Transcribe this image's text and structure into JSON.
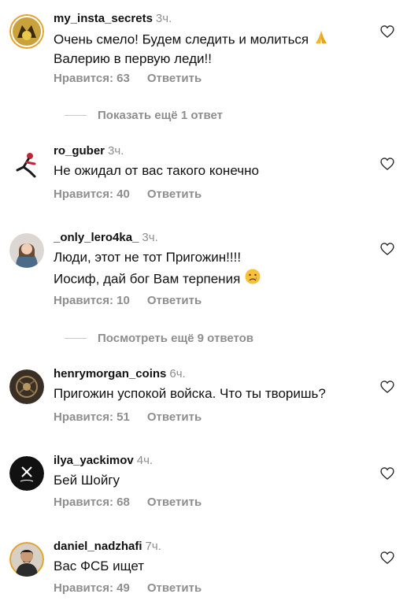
{
  "comments": [
    {
      "username": "my_insta_secrets",
      "time": "3ч.",
      "lines": [
        "Очень смело! Будем следить и молиться",
        "Валерию в первую леди!!"
      ],
      "likes": "Нравится: 63",
      "reply": "Ответить",
      "avatar_icon": "fox-avatar-icon",
      "emoji": "folded-hands-emoji"
    },
    {
      "username": "ro_guber",
      "time": "3ч.",
      "lines": [
        "Не ожидал от вас такого конечно"
      ],
      "likes": "Нравится: 40",
      "reply": "Ответить",
      "avatar_icon": "runner-avatar-icon"
    },
    {
      "username": "_only_lero4ka_",
      "time": "3ч.",
      "lines": [
        "Люди, этот не тот Пригожин!!!!",
        "Иосиф, дай бог Вам терпения"
      ],
      "likes": "Нравится: 10",
      "reply": "Ответить",
      "avatar_icon": "girl-avatar-icon",
      "emoji": "crying-face-emoji"
    },
    {
      "username": "henrymorgan_coins",
      "time": "6ч.",
      "lines": [
        "Пригожин успокой войска. Что ты творишь?"
      ],
      "likes": "Нравится: 51",
      "reply": "Ответить",
      "avatar_icon": "dark-pattern-avatar-icon"
    },
    {
      "username": "ilya_yackimov",
      "time": "4ч.",
      "lines": [
        "Бей Шойгу"
      ],
      "likes": "Нравится: 68",
      "reply": "Ответить",
      "avatar_icon": "monogram-avatar-icon"
    },
    {
      "username": "daniel_nadzhafi",
      "time": "7ч.",
      "lines": [
        "Вас ФСБ ищет"
      ],
      "likes": "Нравится: 49",
      "reply": "Ответить",
      "avatar_icon": "man-avatar-icon"
    }
  ],
  "more_replies": [
    {
      "label": "Показать ещё 1 ответ"
    },
    {
      "label": "Посмотреть ещё 9 ответов"
    }
  ],
  "colors": {
    "text": "#111111",
    "secondary": "#8e8e8e",
    "story_ring": "#e4a22c"
  }
}
